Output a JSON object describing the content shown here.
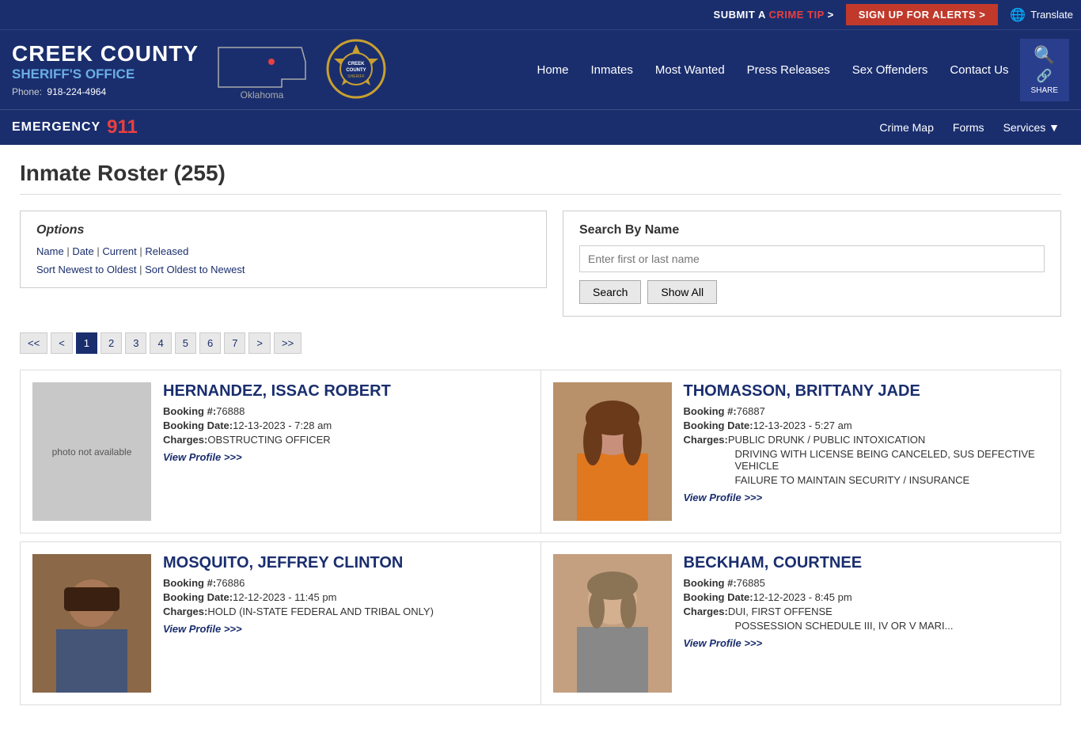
{
  "topBar": {
    "submitTip": "SUBMIT A",
    "crimeTip": "CRIME TIP",
    "arrow": ">",
    "alertBtn": "SIGN UP FOR ALERTS >",
    "translate": "Translate"
  },
  "header": {
    "countyName": "CREEK COUNTY",
    "officeName": "SHERIFF'S OFFICE",
    "phoneLabel": "Phone:",
    "phoneNumber": "918-224-4964",
    "stateName": "Oklahoma"
  },
  "mainNav": {
    "items": [
      {
        "label": "Home",
        "href": "#"
      },
      {
        "label": "Inmates",
        "href": "#"
      },
      {
        "label": "Most Wanted",
        "href": "#"
      },
      {
        "label": "Press Releases",
        "href": "#"
      },
      {
        "label": "Sex Offenders",
        "href": "#"
      },
      {
        "label": "Contact Us",
        "href": "#"
      }
    ],
    "shareLabel": "SHARE"
  },
  "secondaryNav": {
    "emergencyLabel": "EMERGENCY",
    "emergencyNumber": "911",
    "links": [
      {
        "label": "Crime Map"
      },
      {
        "label": "Forms"
      },
      {
        "label": "Services ▾"
      }
    ]
  },
  "page": {
    "title": "Inmate Roster (255)"
  },
  "options": {
    "heading": "Options",
    "filterLinks": [
      {
        "label": "Name"
      },
      {
        "label": "Date"
      },
      {
        "label": "Current"
      },
      {
        "label": "Released"
      }
    ],
    "sortLinks": [
      {
        "label": "Sort Newest to Oldest"
      },
      {
        "label": "Sort Oldest to Newest"
      }
    ]
  },
  "search": {
    "heading": "Search By Name",
    "placeholder": "Enter first or last name",
    "searchBtn": "Search",
    "showAllBtn": "Show All"
  },
  "pagination": {
    "first": "<<",
    "prev": "<",
    "pages": [
      "1",
      "2",
      "3",
      "4",
      "5",
      "6",
      "7"
    ],
    "activePage": "1",
    "next": ">",
    "last": ">>"
  },
  "inmates": [
    {
      "id": 1,
      "name": "HERNANDEZ, ISSAC ROBERT",
      "bookingNum": "76888",
      "bookingDate": "12-13-2023 - 7:28 am",
      "chargesLabel": "Charges:",
      "charges": [
        "OBSTRUCTING OFFICER"
      ],
      "viewProfile": "View Profile >>>",
      "hasPhoto": false,
      "photoPlaceholder": "photo not available"
    },
    {
      "id": 2,
      "name": "THOMASSON, BRITTANY JADE",
      "bookingNum": "76887",
      "bookingDate": "12-13-2023 - 5:27 am",
      "chargesLabel": "Charges:",
      "charges": [
        "PUBLIC DRUNK / PUBLIC INTOXICATION",
        "DRIVING WITH LICENSE BEING CANCELED, SUS DEFECTIVE VEHICLE",
        "FAILURE TO MAINTAIN SECURITY / INSURANCE"
      ],
      "viewProfile": "View Profile >>>",
      "hasPhoto": true,
      "photoColor": "#c8a882"
    },
    {
      "id": 3,
      "name": "MOSQUITO, JEFFREY CLINTON",
      "bookingNum": "76886",
      "bookingDate": "12-12-2023 - 11:45 pm",
      "chargesLabel": "Charges:",
      "charges": [
        "HOLD (IN-STATE FEDERAL AND TRIBAL ONLY)"
      ],
      "viewProfile": "View Profile >>>",
      "hasPhoto": true,
      "photoColor": "#a87858"
    },
    {
      "id": 4,
      "name": "BECKHAM, COURTNEE",
      "bookingNum": "76885",
      "bookingDate": "12-12-2023 - 8:45 pm",
      "chargesLabel": "Charges:",
      "charges": [
        "DUI, FIRST OFFENSE",
        "POSSESSION SCHEDULE III, IV OR V MARI..."
      ],
      "viewProfile": "View Profile >>>",
      "hasPhoto": true,
      "photoColor": "#d4b090"
    }
  ]
}
